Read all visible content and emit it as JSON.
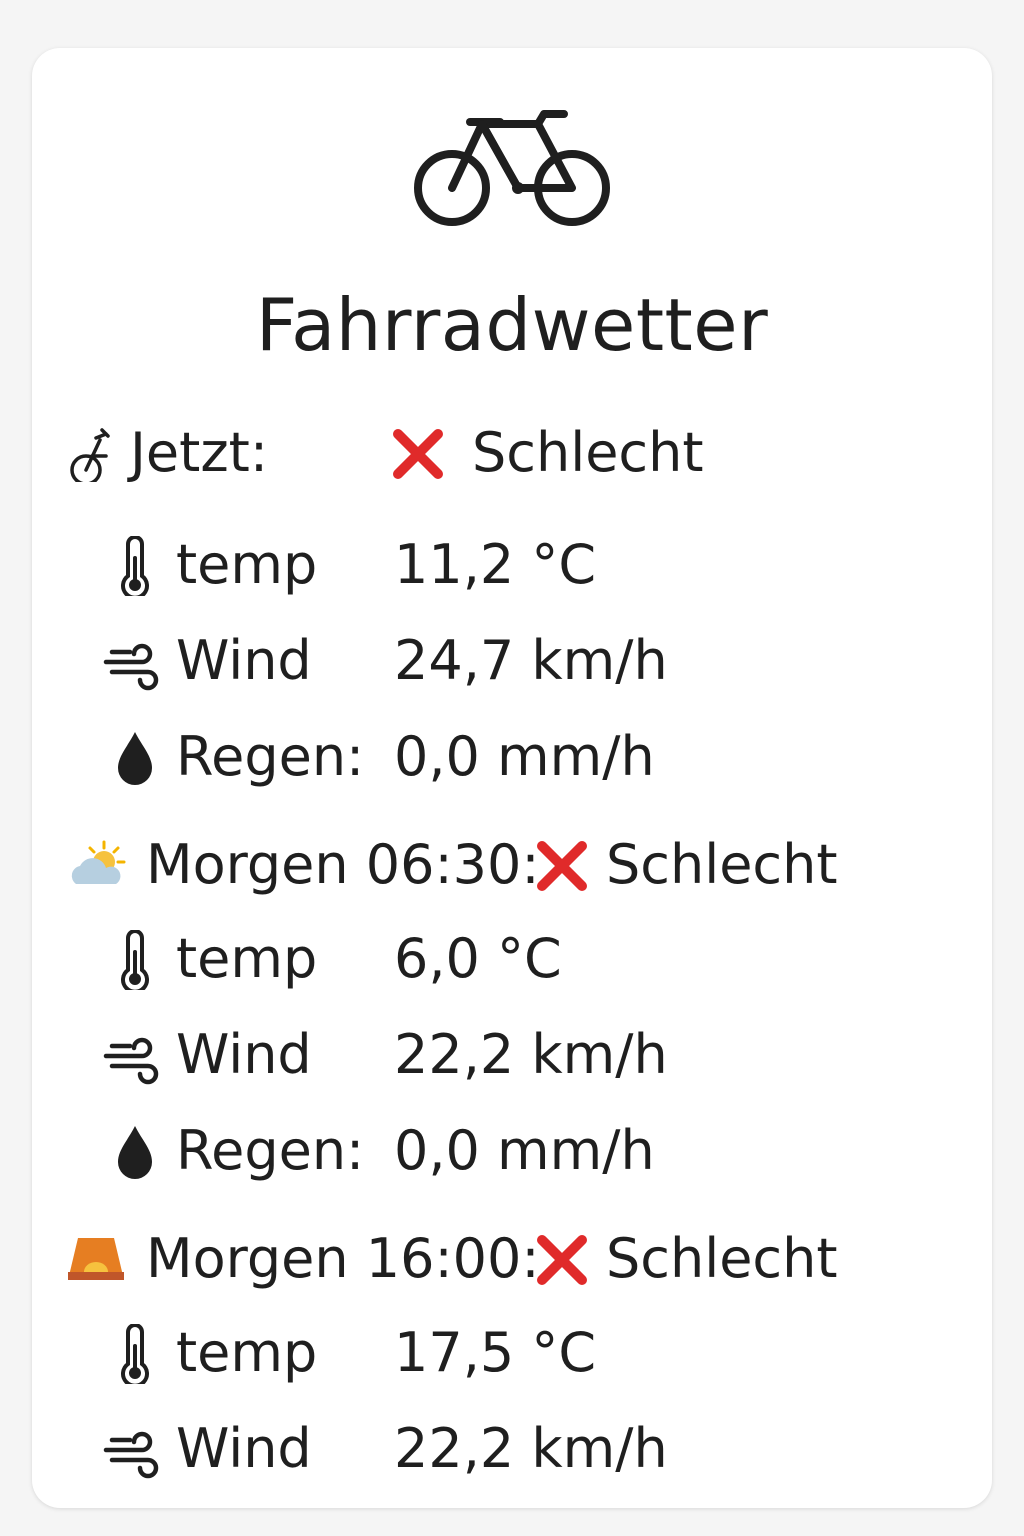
{
  "card": {
    "icon": "bicycle-icon",
    "title": "Fahrradwetter"
  },
  "status_icon": "red-cross-icon",
  "colors": {
    "status_bad": "#e02a2a",
    "text": "#1f1f1f"
  },
  "sections": [
    {
      "icon": "cyclist-icon",
      "label": "Jetzt:",
      "status": "Schlecht",
      "rows": [
        {
          "icon": "thermometer-icon",
          "label": "temp",
          "value": "11,2 °C"
        },
        {
          "icon": "wind-icon",
          "label": "Wind",
          "value": "24,7 km/h"
        },
        {
          "icon": "rain-drop-icon",
          "label": "Regen:",
          "value": "0,0 mm/h"
        }
      ]
    },
    {
      "icon": "sun-behind-cloud-icon",
      "label": "Morgen 06:30:",
      "status": "Schlecht",
      "rows": [
        {
          "icon": "thermometer-icon",
          "label": "temp",
          "value": "6,0 °C"
        },
        {
          "icon": "wind-icon",
          "label": "Wind",
          "value": "22,2 km/h"
        },
        {
          "icon": "rain-drop-icon",
          "label": "Regen:",
          "value": "0,0 mm/h"
        }
      ]
    },
    {
      "icon": "sunset-icon",
      "label": "Morgen 16:00:",
      "status": "Schlecht",
      "rows": [
        {
          "icon": "thermometer-icon",
          "label": "temp",
          "value": "17,5 °C"
        },
        {
          "icon": "wind-icon",
          "label": "Wind",
          "value": "22,2 km/h"
        }
      ]
    }
  ]
}
